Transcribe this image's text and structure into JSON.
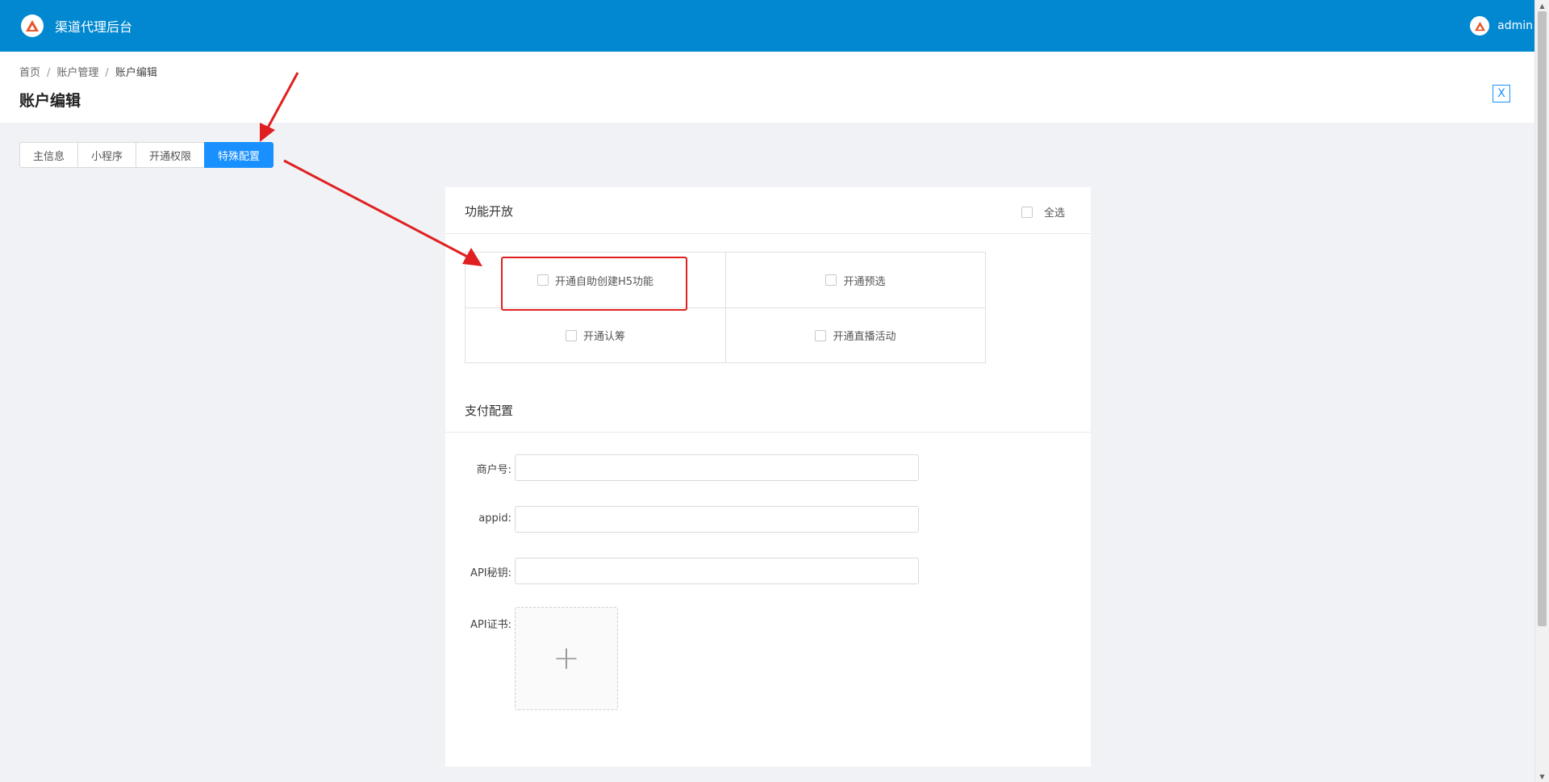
{
  "app": {
    "title": "渠道代理后台",
    "user": "admin",
    "logo_icon": "triangle-logo-icon"
  },
  "breadcrumb": [
    "首页",
    "账户管理",
    "账户编辑"
  ],
  "page": {
    "title": "账户编辑",
    "close_label": "X"
  },
  "tabs": [
    {
      "label": "主信息",
      "active": false
    },
    {
      "label": "小程序",
      "active": false
    },
    {
      "label": "开通权限",
      "active": false
    },
    {
      "label": "特殊配置",
      "active": true
    }
  ],
  "features": {
    "title": "功能开放",
    "select_all_label": "全选",
    "items": [
      {
        "label": "开通自助创建H5功能",
        "checked": false
      },
      {
        "label": "开通预选",
        "checked": false
      },
      {
        "label": "开通认筹",
        "checked": false
      },
      {
        "label": "开通直播活动",
        "checked": false
      }
    ]
  },
  "payment": {
    "title": "支付配置",
    "fields": [
      {
        "label": "商户号:",
        "value": ""
      },
      {
        "label": "appid:",
        "value": ""
      },
      {
        "label": "API秘钥:",
        "value": ""
      }
    ],
    "cert_label": "API证书:",
    "upload_icon": "+"
  },
  "colors": {
    "topbar": "#0288d1",
    "accent": "#1890ff",
    "annotation": "#e02020"
  }
}
